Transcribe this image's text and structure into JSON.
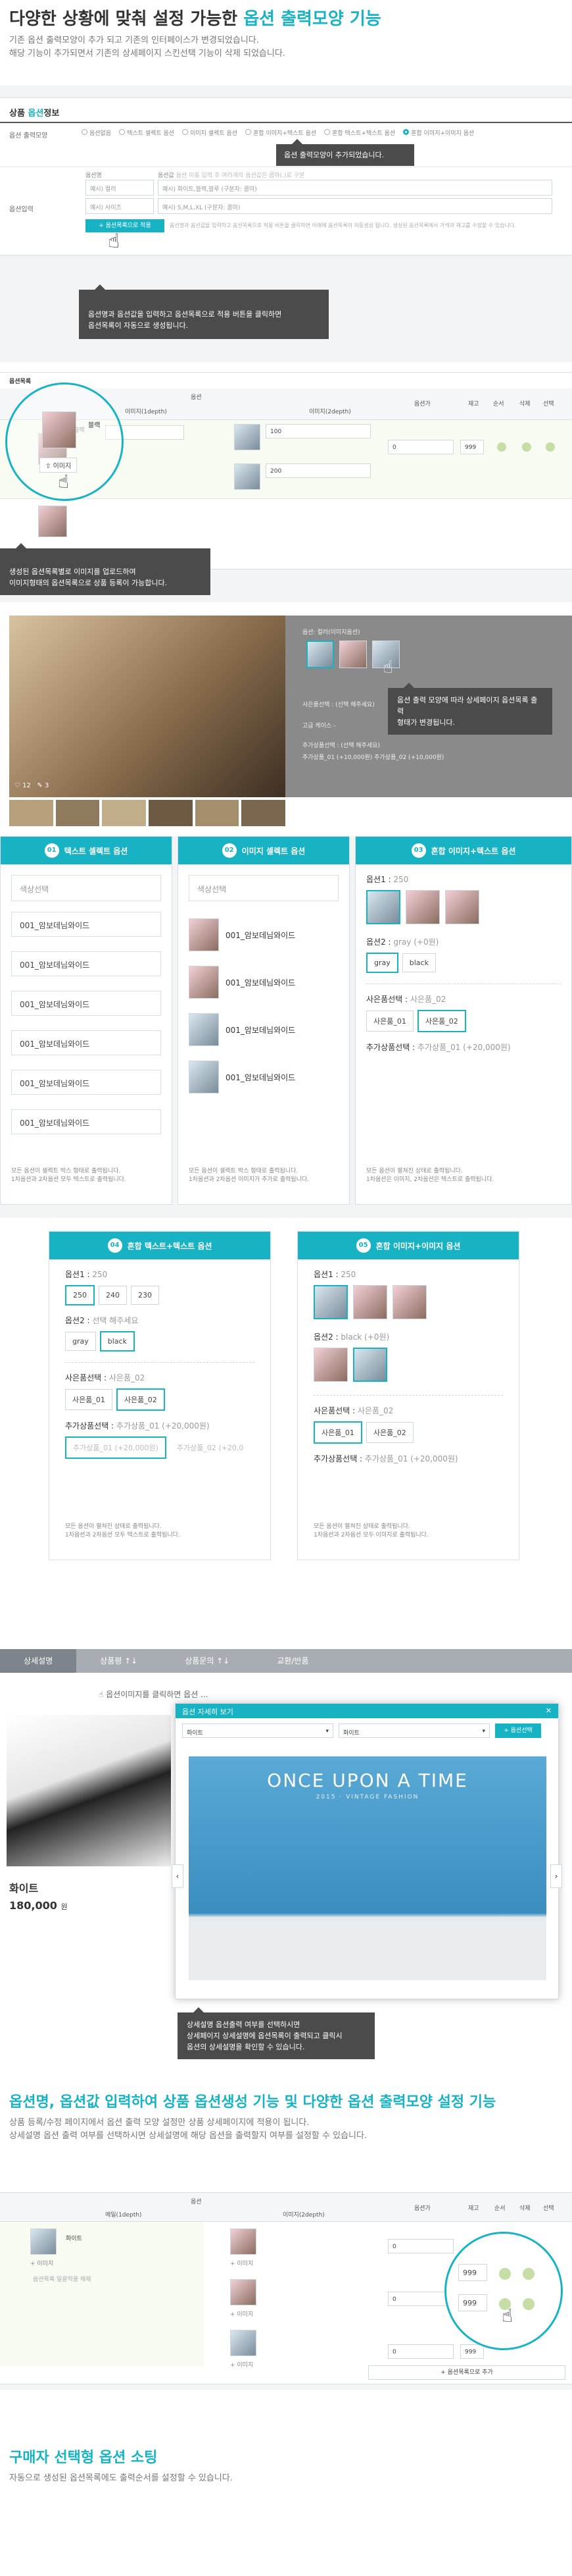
{
  "intro": {
    "title_prefix": "다양한 상황에 맞춰 설정 가능한",
    "title_highlight": "옵션 출력모양 기능",
    "desc1": "기존 옵션 출력모양이 추가 되고 기존의 인터페이스가 변경되었습니다.",
    "desc2": "해당 기능이 추가되면서 기존의 상세페이지 스킨선택 기능이 삭제 되었습니다."
  },
  "form": {
    "section_title_prefix": "상품",
    "section_title_highlight": "옵션",
    "section_title_suffix": "정보",
    "row1_label": "옵션 출력모양",
    "radios": [
      "옵션없음",
      "텍스트 셀렉트 옵션",
      "이미지 셀렉트 옵션",
      "혼합 이미지+텍스트 옵션",
      "혼합 텍스트+텍스트 옵션",
      "혼합 이미지+이미지 옵션"
    ],
    "tooltip_added": "옵션 출력모양이 추가되었습니다.",
    "row2_label": "옵션입력",
    "col_option_name": "옵션명",
    "col_option_value": "옵션값",
    "col_value_hint": "옵션 이름 입력 후 여러개의 옵션값은 콤마(,)로 구분",
    "placeholder_name1": "예시) 컬러",
    "placeholder_value1": "예시) 화이트,블랙,블루 (구분자: 콤마)",
    "placeholder_name2": "예시) 사이즈",
    "placeholder_value2": "예시) S,M,L,XL (구분자: 콤마)",
    "apply_button": "+ 옵션목록으로 적용",
    "apply_note": "옵션명과 옵션값을 입력하고 옵션목록으로 적용 버튼을 클릭하면 아래에 옵션목록이 자동생성 됩니다. 생성된 옵션목록에서 가격과 재고를 수정할 수 있습니다.",
    "tooltip_apply": "옵션명과 옵션값을 입력하고 옵션목록으로 적용 버튼을 클릭하면\n옵션목록이 자동으로 생성됩니다."
  },
  "optlist": {
    "title": "옵션목록",
    "col_option": "옵션",
    "col_depth1": "이미지(1depth)",
    "col_depth2": "이미지(2depth)",
    "col_price": "옵션가",
    "col_stock": "재고",
    "col_order": "순서",
    "col_delete": "삭제",
    "col_use": "선택",
    "item1": "블랙",
    "image_btn": "이미지",
    "value_100": "100",
    "value_200": "200",
    "value_0": "0",
    "value_999": "999",
    "tooltip": "생성된 옵션목록별로 이미지를 업로드하여\n이미지형태의 옵션목록으로 상품 등록이 가능합니다."
  },
  "preview": {
    "option_label": "옵션:",
    "option_value": "컬러(이미지옵션)",
    "tooltip": "옵션 출력 모양에 따라 상세페이지 옵션목록 출력\n형태가 변경됩니다.",
    "counts": [
      "12",
      "3"
    ],
    "line1": "사은품선택 : (선택 해주세요)",
    "line2": "고급 케이스 -",
    "line3": "추가상품선택 : (선택 해주세요)",
    "line4": "추가상품_01 (+10,000원)   추가상품_02 (+10,000원)"
  },
  "panels": {
    "p1_num": "01",
    "p1_title": "텍스트 셀렉트 옵션",
    "p1_select_label": "색상선택",
    "p1_items": [
      "001_암보데님와이드",
      "001_암보데님와이드",
      "001_암보데님와이드",
      "001_암보데님와이드",
      "001_암보데님와이드",
      "001_암보데님와이드"
    ],
    "p1_note": "모든 옵션이 셀렉트 박스 형태로 출력됩니다.\n1차옵션과 2차옵션 모두 텍스트로 출력됩니다.",
    "p2_num": "02",
    "p2_title": "이미지 셀렉트 옵션",
    "p2_select_label": "색상선택",
    "p2_items": [
      "001_암보데님와이드",
      "001_암보데님와이드",
      "001_암보데님와이드",
      "001_암보데님와이드"
    ],
    "p2_note": "모든 옵션이 셀렉트 박스 형태로 출력됩니다.\n1차옵션과 2차옵션 이미지가 추가로 출력됩니다.",
    "p3_num": "03",
    "p3_title": "혼합 이미지+텍스트 옵션",
    "p3_opt1_label": "옵션1 : ",
    "p3_opt1_val": "250",
    "p3_opt2_label": "옵션2 : ",
    "p3_opt2_val": "gray (+0원)",
    "p3_chips": [
      "gray",
      "black"
    ],
    "p3_gift_label": "사은품선택 : ",
    "p3_gift_val": "사은품_02",
    "p3_gifts": [
      "사은품_01",
      "사은품_02"
    ],
    "p3_add_label": "추가상품선택 : ",
    "p3_add_val": "추가상품_01 (+20,000원)",
    "p3_note": "모든 옵션이 펼쳐진 상태로 출력됩니다.\n1차옵션은 이미지, 2차옵션은 텍스트로 출력됩니다.",
    "p4_num": "04",
    "p4_title": "혼합 텍스트+텍스트 옵션",
    "p4_opt1_label": "옵션1 : ",
    "p4_opt1_val": "250",
    "p4_sizes": [
      "250",
      "240",
      "230"
    ],
    "p4_opt2_label": "옵션2 : ",
    "p4_opt2_val": "선택 해주세요",
    "p4_chips": [
      "gray",
      "black"
    ],
    "p4_gift_label": "사은품선택 : ",
    "p4_gift_val": "사은품_02",
    "p4_gifts": [
      "사은품_01",
      "사은품_02"
    ],
    "p4_add_label": "추가상품선택 : ",
    "p4_add_val": "추가상품_01 (+20,000원)",
    "p4_add_items": [
      "추가상품_01 (+20,000원)",
      "추가상품_02 (+20,0"
    ],
    "p4_note": "모든 옵션이 펼쳐진 상태로 출력됩니다.\n1차옵션과 2차옵션 모두 텍스트로 출력됩니다.",
    "p5_num": "05",
    "p5_title": "혼합 이미지+이미지 옵션",
    "p5_opt1_label": "옵션1 : ",
    "p5_opt1_val": "250",
    "p5_opt2_label": "옵션2 : ",
    "p5_opt2_val": "black (+0원)",
    "p5_gift_label": "사은품선택 : ",
    "p5_gift_val": "사은품_02",
    "p5_gifts": [
      "사은품_01",
      "사은품_02"
    ],
    "p5_add_label": "추가상품선택 : ",
    "p5_add_val": "추가상품_01 (+20,000원)",
    "p5_note": "모든 옵션이 펼쳐진 상태로 출력됩니다.\n1차옵션과 2차옵션 모두 이미지로 출력됩니다."
  },
  "detail": {
    "tabs": [
      "상세설명",
      "상품평 ↑↓",
      "상품문의 ↑↓",
      "교환/반품"
    ],
    "banner": "옵션이미지를 클릭하면 옵션 ...",
    "modal_title": "옵션 자세히 보기",
    "modal_select1": "화이트",
    "modal_select2": "화이트",
    "modal_button": "+ 옵션선택",
    "hero_title": "ONCE UPON A TIME",
    "hero_sub": "2015 · VINTAGE FASHION",
    "product_name": "화이트",
    "price": "180,000",
    "price_unit": "원",
    "tooltip": "상세설명 옵션출력 여부를 선택하시면\n상세페이지 상세설명에 옵션목록이 출력되고 클릭시\n옵션의 상세설명을 확인할 수 있습니다."
  },
  "section2": {
    "title": "옵션명, 옵션값 입력하여 상품 옵션생성 기능 및 다양한 옵션 출력모양 설정 기능",
    "desc1": "상품 등록/수정 페이지에서 옵션 출력 모양 설정만 상품 상세페이지에 적용이 됩니다.",
    "desc2": "상세설명 옵션 출력 여부를 선택하시면 상세설명에 해당 옵션을 출력할지 여부를 설정할 수 있습니다."
  },
  "table2": {
    "col_option": "옵션",
    "col_d1": "메일(1depth)",
    "col_d2": "이미지(2depth)",
    "col_price": "옵션가",
    "col_stock": "재고",
    "col_order": "순서",
    "col_delete": "삭제",
    "col_use": "선택",
    "item1": "화이트",
    "add_btn": "+ 이미지",
    "note": "옵션목록 일괄적용 해제",
    "v0": "0",
    "v999": "999",
    "footer_btn": "+ 옵션목록으로 추가"
  },
  "section3": {
    "title": "구매자 선택형 옵션 소팅",
    "desc": "자동으로 생성된 옵션목록에도 출력순서를 설정할 수 있습니다."
  }
}
